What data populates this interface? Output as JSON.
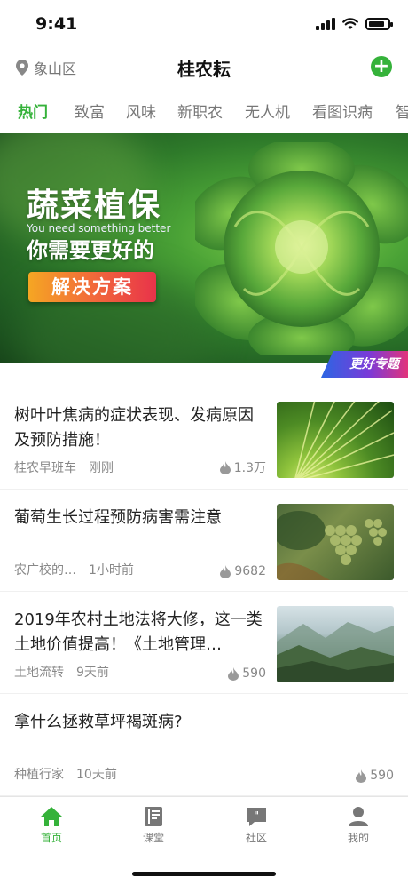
{
  "status_bar": {
    "time": "9:41",
    "battery_level": 0.85
  },
  "nav": {
    "location": "象山区",
    "title": "桂农耘"
  },
  "tabs": [
    {
      "label": "热门",
      "active": true
    },
    {
      "label": "致富"
    },
    {
      "label": "风味"
    },
    {
      "label": "新职农"
    },
    {
      "label": "无人机"
    },
    {
      "label": "看图识病"
    },
    {
      "label": "智"
    }
  ],
  "banner": {
    "title": "蔬菜植保",
    "subtitle_en": "You need something better",
    "subtitle_cn": "你需要更好的",
    "button": "解决方案",
    "tag": "更好专题"
  },
  "articles": [
    {
      "title": "树叶叶焦病的症状表现、发病原因及预防措施！",
      "source": "桂农早班车",
      "time": "刚刚",
      "views": "1.3万",
      "thumb": "palm-leaf-image"
    },
    {
      "title": "葡萄生长过程预防病害需注意",
      "source": "农广校的…",
      "time": "1小时前",
      "views": "9682",
      "thumb": "grapes-image"
    },
    {
      "title": "2019年农村土地法将大修，这一类土地价值提高！《土地管理…",
      "source": "土地流转",
      "time": "9天前",
      "views": "590",
      "thumb": "mountain-landscape-image"
    },
    {
      "title": "拿什么拯救草坪褐斑病?",
      "source": "种植行家",
      "time": "10天前",
      "views": "590",
      "thumb": null
    }
  ],
  "tabbar": [
    {
      "label": "首页",
      "icon": "home-icon",
      "active": true
    },
    {
      "label": "课堂",
      "icon": "book-icon"
    },
    {
      "label": "社区",
      "icon": "chat-icon"
    },
    {
      "label": "我的",
      "icon": "user-icon"
    }
  ],
  "colors": {
    "accent": "#35b23a"
  }
}
